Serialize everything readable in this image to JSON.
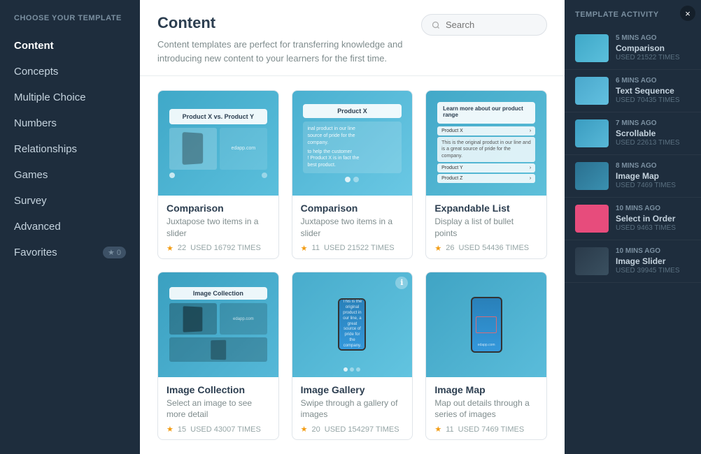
{
  "modal": {
    "close_label": "×"
  },
  "sidebar": {
    "title": "CHOOSE YOUR TEMPLATE",
    "items": [
      {
        "id": "content",
        "label": "Content",
        "active": true,
        "badge": null
      },
      {
        "id": "concepts",
        "label": "Concepts",
        "active": false,
        "badge": null
      },
      {
        "id": "multiple-choice",
        "label": "Multiple Choice",
        "active": false,
        "badge": null
      },
      {
        "id": "numbers",
        "label": "Numbers",
        "active": false,
        "badge": null
      },
      {
        "id": "relationships",
        "label": "Relationships",
        "active": false,
        "badge": null
      },
      {
        "id": "games",
        "label": "Games",
        "active": false,
        "badge": null
      },
      {
        "id": "survey",
        "label": "Survey",
        "active": false,
        "badge": null
      },
      {
        "id": "advanced",
        "label": "Advanced",
        "active": false,
        "badge": null
      },
      {
        "id": "favorites",
        "label": "Favorites",
        "active": false,
        "badge": "0"
      }
    ]
  },
  "main": {
    "title": "Content",
    "description": "Content templates are perfect for transferring knowledge and introducing new content to your learners for the first time.",
    "search": {
      "placeholder": "Search"
    },
    "templates": [
      {
        "id": "comparison1",
        "name": "Comparison",
        "description": "Juxtapose two items in a slider",
        "stars": 22,
        "used_times": "USED 16792 TIMES",
        "thumb_type": "comparison1"
      },
      {
        "id": "comparison2",
        "name": "Comparison",
        "description": "Juxtapose two items in a slider",
        "stars": 11,
        "used_times": "USED 21522 TIMES",
        "thumb_type": "comparison2"
      },
      {
        "id": "expandable-list",
        "name": "Expandable List",
        "description": "Display a list of bullet points",
        "stars": 26,
        "used_times": "USED 54436 TIMES",
        "thumb_type": "expandable"
      },
      {
        "id": "image-collection",
        "name": "Image Collection",
        "description": "Select an image to see more detail",
        "stars": 15,
        "used_times": "USED 43007 TIMES",
        "thumb_type": "image-collection"
      },
      {
        "id": "image-gallery",
        "name": "Image Gallery",
        "description": "Swipe through a gallery of images",
        "stars": 20,
        "used_times": "USED 154297 TIMES",
        "thumb_type": "image-gallery"
      },
      {
        "id": "image-map",
        "name": "Image Map",
        "description": "Map out details through a series of images",
        "stars": 11,
        "used_times": "USED 7469 TIMES",
        "thumb_type": "image-map"
      }
    ]
  },
  "activity": {
    "title": "TEMPLATE ACTIVITY",
    "items": [
      {
        "time": "5 MINS AGO",
        "name": "Comparison",
        "used": "USED 21522 TIMES",
        "thumb_class": "act-thumb-1"
      },
      {
        "time": "6 MINS AGO",
        "name": "Text Sequence",
        "used": "USED 70435 TIMES",
        "thumb_class": "act-thumb-2"
      },
      {
        "time": "7 MINS AGO",
        "name": "Scrollable",
        "used": "USED 22613 TIMES",
        "thumb_class": "act-thumb-3"
      },
      {
        "time": "8 MINS AGO",
        "name": "Image Map",
        "used": "USED 7469 TIMES",
        "thumb_class": "act-thumb-4"
      },
      {
        "time": "10 MINS AGO",
        "name": "Select in Order",
        "used": "USED 9463 TIMES",
        "thumb_class": "act-thumb-5"
      },
      {
        "time": "10 MINS AGO",
        "name": "Image Slider",
        "used": "USED 39945 TIMES",
        "thumb_class": "act-thumb-6"
      }
    ]
  }
}
